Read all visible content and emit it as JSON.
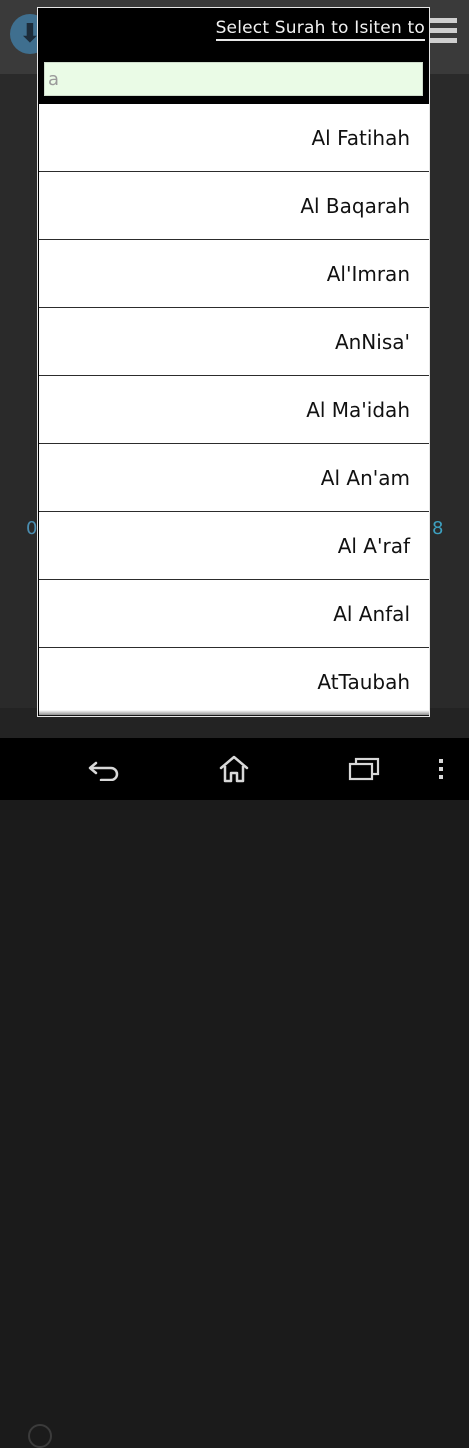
{
  "dialog": {
    "title": "Select Surah to Isiten to",
    "search_value": "a"
  },
  "background": {
    "left_number": "0",
    "right_number": "8"
  },
  "surahs": [
    "Al Fatihah",
    "Al Baqarah",
    "Al'Imran",
    "AnNisa'",
    "Al Ma'idah",
    "Al An'am",
    "Al A'raf",
    "Al Anfal",
    "AtTaubah"
  ],
  "icons": {
    "download": "download-icon",
    "menu": "hamburger-menu-icon",
    "back": "back-icon",
    "home": "home-icon",
    "recent": "recent-apps-icon",
    "more": "more-vert-icon"
  }
}
